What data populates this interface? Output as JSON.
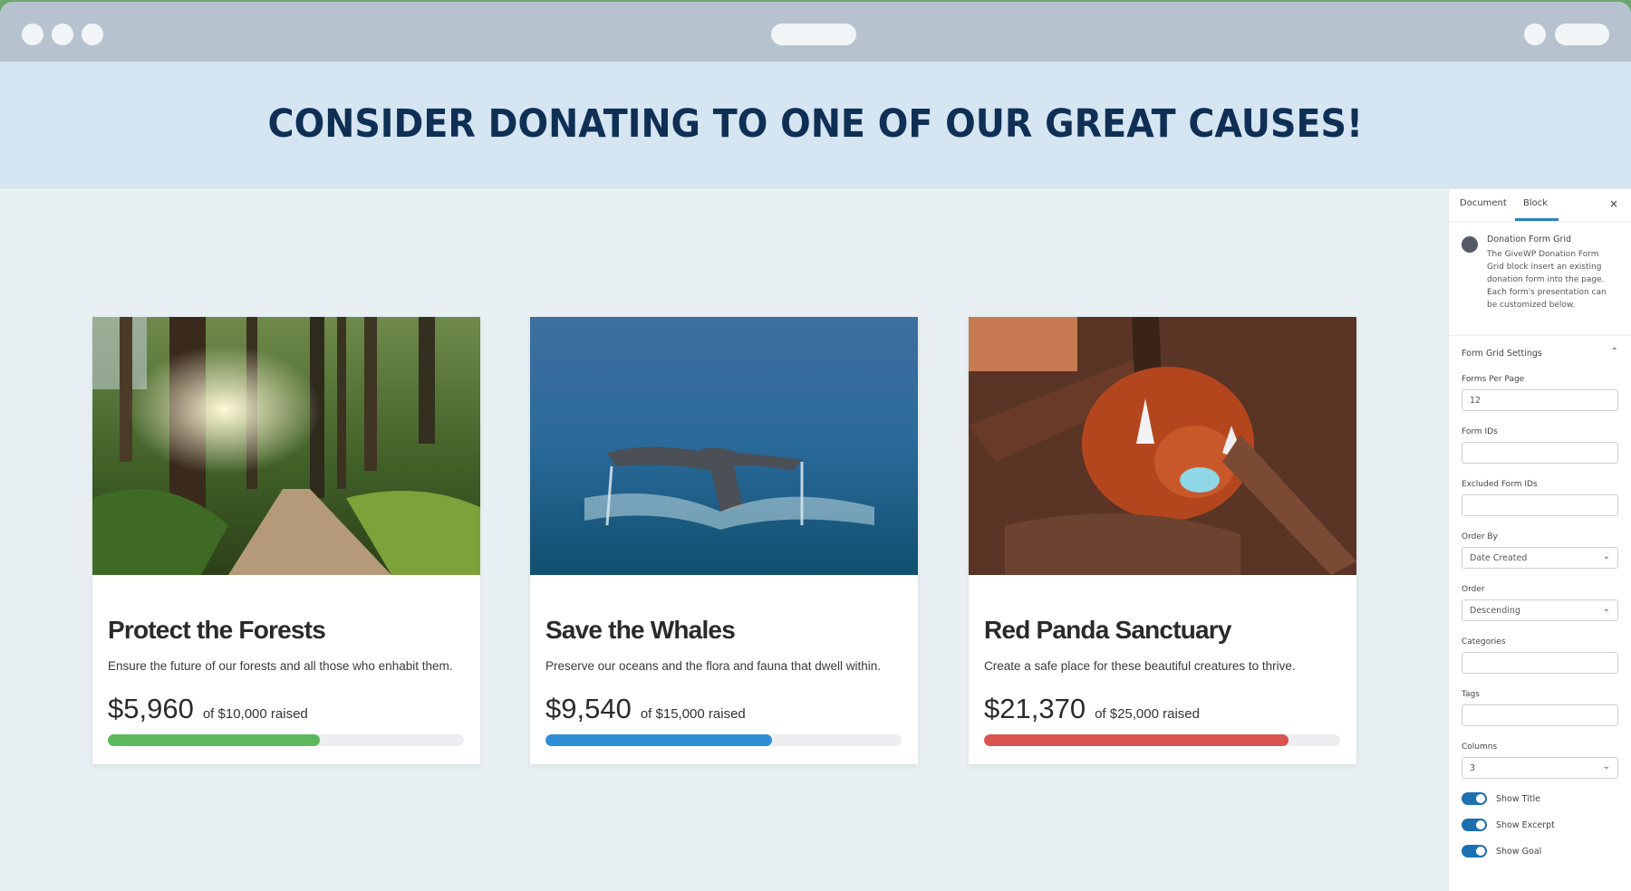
{
  "hero": {
    "title": "CONSIDER DONATING TO ONE OF OUR GREAT CAUSES!"
  },
  "cards": [
    {
      "title": "Protect the Forests",
      "excerpt": "Ensure the future of our forests and all those who enhabit them.",
      "raised": "$5,960",
      "goal_text": "of $10,000 raised",
      "progress_percent": 59.6,
      "bar_color": "#5cb85c",
      "image": "forest-path-photo"
    },
    {
      "title": "Save the Whales",
      "excerpt": "Preserve our oceans and the flora and fauna that dwell within.",
      "raised": "$9,540",
      "goal_text": "of $15,000 raised",
      "progress_percent": 63.6,
      "bar_color": "#2f8fd6",
      "image": "whale-tail-photo"
    },
    {
      "title": "Red Panda Sanctuary",
      "excerpt": "Create a safe place for these beautiful creatures to thrive.",
      "raised": "$21,370",
      "goal_text": "of $25,000 raised",
      "progress_percent": 85.5,
      "bar_color": "#d9534f",
      "image": "red-panda-photo"
    }
  ],
  "panel": {
    "tabs": [
      "Document",
      "Block"
    ],
    "active_tab": "Block",
    "close_icon": "×",
    "block_title": "Donation Form Grid",
    "block_description": "The GiveWP Donation Form Grid block insert an existing donation form into the page. Each form's presentation can be customized below.",
    "section_title": "Form Grid Settings",
    "fields": {
      "forms_per_page": {
        "label": "Forms Per Page",
        "value": "12"
      },
      "form_ids": {
        "label": "Form IDs",
        "value": ""
      },
      "excluded_form_ids": {
        "label": "Excluded Form IDs",
        "value": ""
      },
      "order_by": {
        "label": "Order By",
        "value": "Date Created"
      },
      "order": {
        "label": "Order",
        "value": "Descending"
      },
      "categories": {
        "label": "Categories",
        "value": ""
      },
      "tags": {
        "label": "Tags",
        "value": ""
      },
      "columns": {
        "label": "Columns",
        "value": "3"
      }
    },
    "toggles": [
      {
        "label": "Show Title",
        "on": true
      },
      {
        "label": "Show Excerpt",
        "on": true
      },
      {
        "label": "Show Goal",
        "on": true
      }
    ]
  }
}
